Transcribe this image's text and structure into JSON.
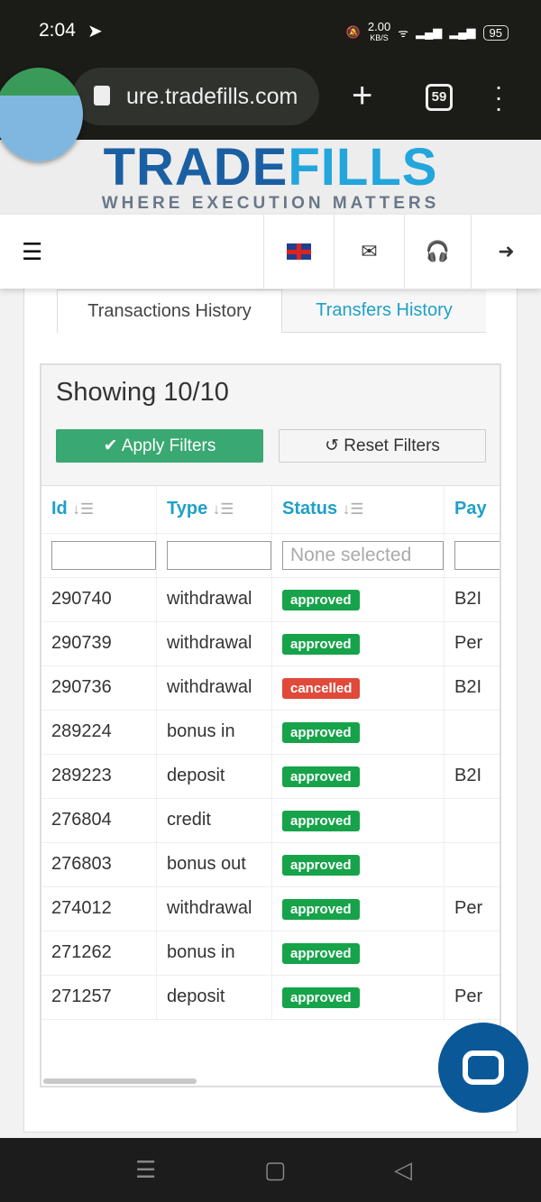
{
  "status_bar": {
    "time": "2:04",
    "speed": "2.00",
    "speed_unit": "KB/S",
    "battery": "95"
  },
  "browser": {
    "url": "ure.tradefills.com",
    "tab_count": "59"
  },
  "logo": {
    "part1": "TRADE",
    "part2": "FILLS",
    "tagline": "WHERE EXECUTION MATTERS"
  },
  "tabs": [
    {
      "label": "Transactions History"
    },
    {
      "label": "Transfers History"
    }
  ],
  "panel": {
    "showing": "Showing 10/10",
    "apply_label": "Apply Filters",
    "reset_label": "Reset Filters"
  },
  "table": {
    "columns": [
      "Id",
      "Type",
      "Status",
      "Pay"
    ],
    "status_filter_placeholder": "None selected",
    "rows": [
      {
        "id": "290740",
        "type": "withdrawal",
        "status": "approved",
        "pay": "B2I"
      },
      {
        "id": "290739",
        "type": "withdrawal",
        "status": "approved",
        "pay": "Per"
      },
      {
        "id": "290736",
        "type": "withdrawal",
        "status": "cancelled",
        "pay": "B2I"
      },
      {
        "id": "289224",
        "type": "bonus in",
        "status": "approved",
        "pay": ""
      },
      {
        "id": "289223",
        "type": "deposit",
        "status": "approved",
        "pay": "B2I"
      },
      {
        "id": "276804",
        "type": "credit",
        "status": "approved",
        "pay": ""
      },
      {
        "id": "276803",
        "type": "bonus out",
        "status": "approved",
        "pay": ""
      },
      {
        "id": "274012",
        "type": "withdrawal",
        "status": "approved",
        "pay": "Per"
      },
      {
        "id": "271262",
        "type": "bonus in",
        "status": "approved",
        "pay": ""
      },
      {
        "id": "271257",
        "type": "deposit",
        "status": "approved",
        "pay": "Per"
      }
    ]
  },
  "colors": {
    "approved": "#16a34a",
    "cancelled": "#e04a3b",
    "accent": "#1fa0c8",
    "apply": "#3aa872"
  }
}
